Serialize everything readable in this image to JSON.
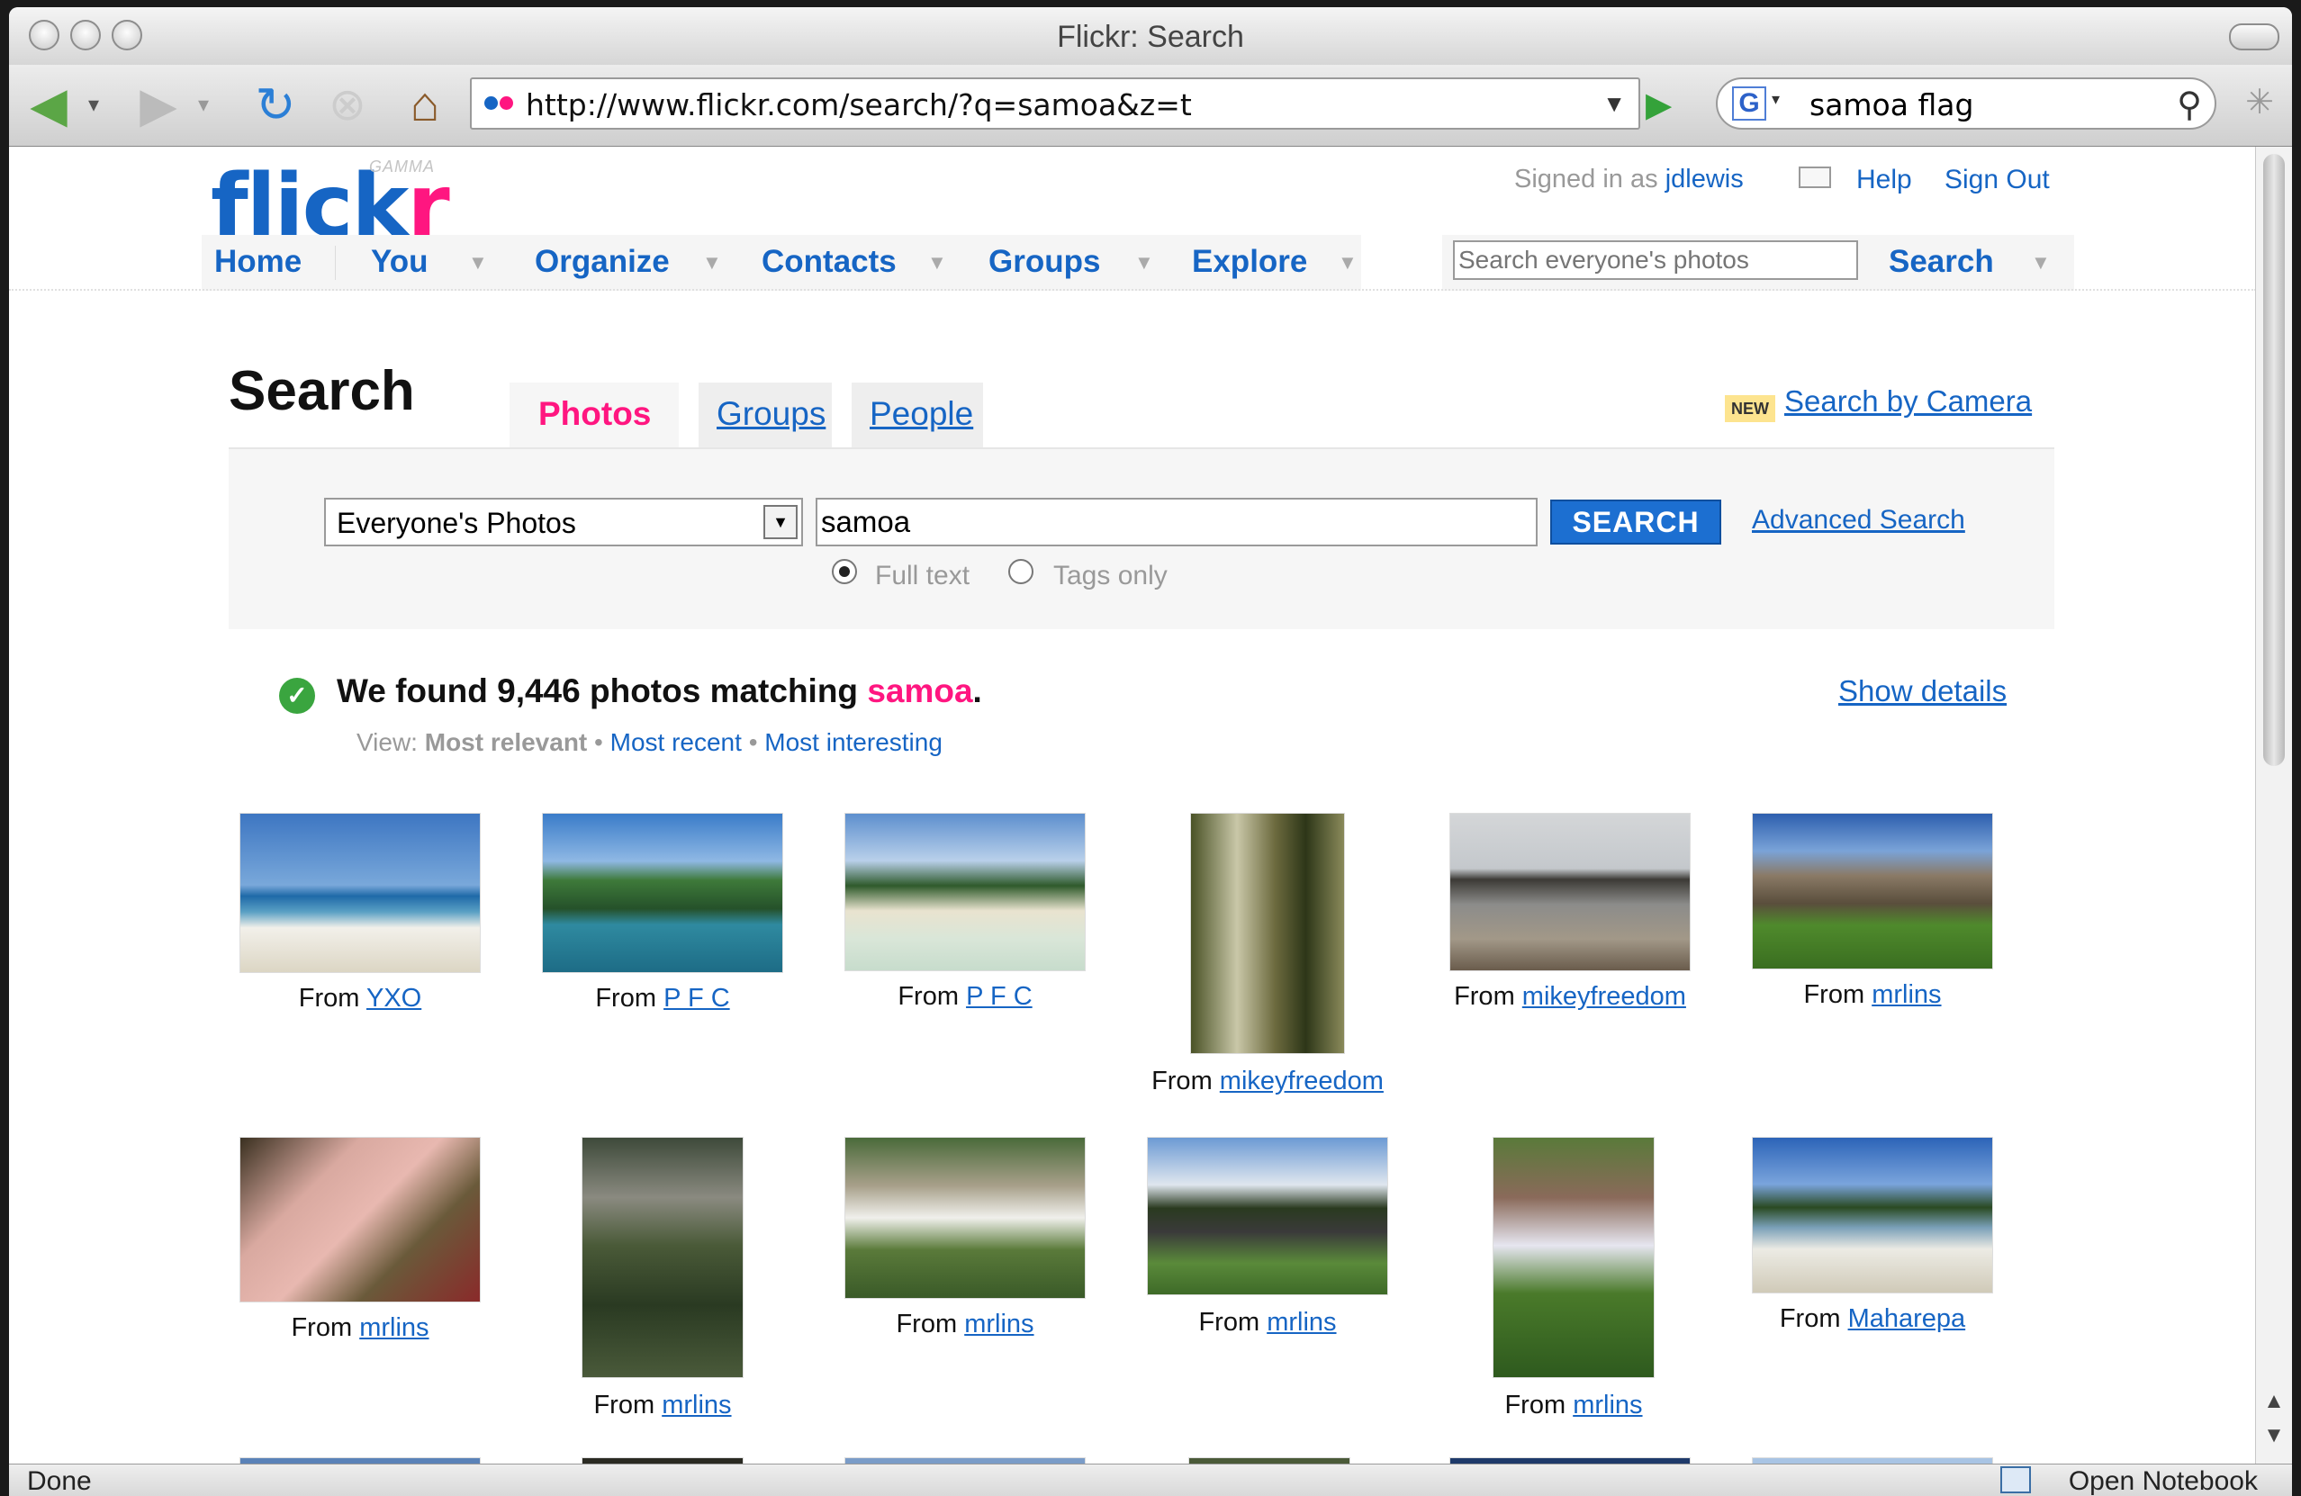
{
  "window": {
    "title": "Flickr: Search"
  },
  "toolbar": {
    "url": "http://www.flickr.com/search/?q=samoa&z=t",
    "search_query": "samoa flag",
    "search_engine_letter": "G"
  },
  "header": {
    "gamma": "GAMMA",
    "signed_in_prefix": "Signed in as",
    "username": "jdlewis",
    "help": "Help",
    "sign_out": "Sign Out"
  },
  "nav": {
    "items": [
      "Home",
      "You",
      "Organize",
      "Contacts",
      "Groups",
      "Explore"
    ],
    "search_placeholder": "Search everyone's photos",
    "search_label": "Search"
  },
  "search": {
    "heading": "Search",
    "tabs": [
      "Photos",
      "Groups",
      "People"
    ],
    "new_badge": "NEW",
    "camera_link": "Search by Camera",
    "scope": "Everyone's Photos",
    "query": "samoa",
    "button": "SEARCH",
    "advanced": "Advanced Search",
    "radio_full": "Full text",
    "radio_tags": "Tags only"
  },
  "results": {
    "found_prefix": "We found 9,446 photos matching",
    "query": "samoa",
    "period": ".",
    "show_details": "Show details",
    "view_label": "View:",
    "view_current": "Most relevant",
    "view_bullet": "•",
    "view_recent": "Most recent",
    "view_interesting": "Most interesting",
    "from_label": "From",
    "photos": [
      {
        "author": "YXO"
      },
      {
        "author": "P F C"
      },
      {
        "author": "P F C"
      },
      {
        "author": "mikeyfreedom"
      },
      {
        "author": "mikeyfreedom"
      },
      {
        "author": "mrlins"
      },
      {
        "author": "mrlins"
      },
      {
        "author": "mrlins"
      },
      {
        "author": "mrlins"
      },
      {
        "author": "mrlins"
      },
      {
        "author": "mrlins"
      },
      {
        "author": "Maharepa"
      }
    ]
  },
  "status": {
    "left": "Done",
    "right": "Open Notebook"
  }
}
